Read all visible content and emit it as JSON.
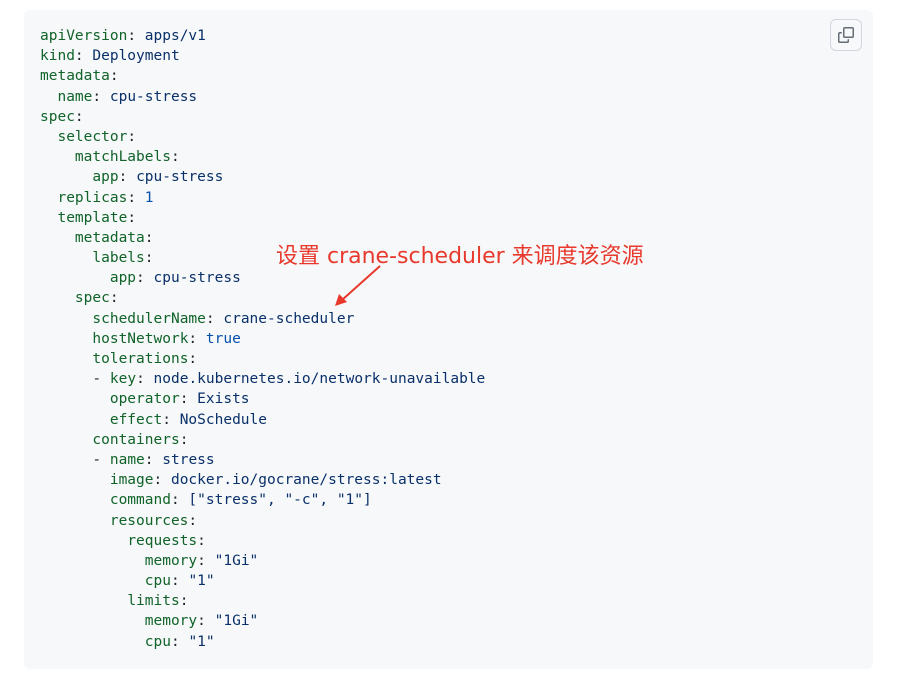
{
  "code": {
    "lines": [
      {
        "indent": "",
        "dash": "",
        "key": "apiVersion",
        "value": "apps/v1",
        "vclass": "v"
      },
      {
        "indent": "",
        "dash": "",
        "key": "kind",
        "value": "Deployment",
        "vclass": "v"
      },
      {
        "indent": "",
        "dash": "",
        "key": "metadata",
        "value": "",
        "vclass": "v"
      },
      {
        "indent": "  ",
        "dash": "",
        "key": "name",
        "value": "cpu-stress",
        "vclass": "v"
      },
      {
        "indent": "",
        "dash": "",
        "key": "spec",
        "value": "",
        "vclass": "v"
      },
      {
        "indent": "  ",
        "dash": "",
        "key": "selector",
        "value": "",
        "vclass": "v"
      },
      {
        "indent": "    ",
        "dash": "",
        "key": "matchLabels",
        "value": "",
        "vclass": "v"
      },
      {
        "indent": "      ",
        "dash": "",
        "key": "app",
        "value": "cpu-stress",
        "vclass": "v"
      },
      {
        "indent": "  ",
        "dash": "",
        "key": "replicas",
        "value": "1",
        "vclass": "n"
      },
      {
        "indent": "  ",
        "dash": "",
        "key": "template",
        "value": "",
        "vclass": "v"
      },
      {
        "indent": "    ",
        "dash": "",
        "key": "metadata",
        "value": "",
        "vclass": "v"
      },
      {
        "indent": "      ",
        "dash": "",
        "key": "labels",
        "value": "",
        "vclass": "v"
      },
      {
        "indent": "        ",
        "dash": "",
        "key": "app",
        "value": "cpu-stress",
        "vclass": "v"
      },
      {
        "indent": "    ",
        "dash": "",
        "key": "spec",
        "value": "",
        "vclass": "v"
      },
      {
        "indent": "      ",
        "dash": "",
        "key": "schedulerName",
        "value": "crane-scheduler",
        "vclass": "v"
      },
      {
        "indent": "      ",
        "dash": "",
        "key": "hostNetwork",
        "value": "true",
        "vclass": "n"
      },
      {
        "indent": "      ",
        "dash": "",
        "key": "tolerations",
        "value": "",
        "vclass": "v"
      },
      {
        "indent": "      ",
        "dash": "- ",
        "key": "key",
        "value": "node.kubernetes.io/network-unavailable",
        "vclass": "v"
      },
      {
        "indent": "        ",
        "dash": "",
        "key": "operator",
        "value": "Exists",
        "vclass": "v"
      },
      {
        "indent": "        ",
        "dash": "",
        "key": "effect",
        "value": "NoSchedule",
        "vclass": "v"
      },
      {
        "indent": "      ",
        "dash": "",
        "key": "containers",
        "value": "",
        "vclass": "v"
      },
      {
        "indent": "      ",
        "dash": "- ",
        "key": "name",
        "value": "stress",
        "vclass": "v"
      },
      {
        "indent": "        ",
        "dash": "",
        "key": "image",
        "value": "docker.io/gocrane/stress:latest",
        "vclass": "v"
      },
      {
        "indent": "        ",
        "dash": "",
        "key": "command",
        "value": "[\"stress\", \"-c\", \"1\"]",
        "vclass": "v"
      },
      {
        "indent": "        ",
        "dash": "",
        "key": "resources",
        "value": "",
        "vclass": "v"
      },
      {
        "indent": "          ",
        "dash": "",
        "key": "requests",
        "value": "",
        "vclass": "v"
      },
      {
        "indent": "            ",
        "dash": "",
        "key": "memory",
        "value": "\"1Gi\"",
        "vclass": "v"
      },
      {
        "indent": "            ",
        "dash": "",
        "key": "cpu",
        "value": "\"1\"",
        "vclass": "v"
      },
      {
        "indent": "          ",
        "dash": "",
        "key": "limits",
        "value": "",
        "vclass": "v"
      },
      {
        "indent": "            ",
        "dash": "",
        "key": "memory",
        "value": "\"1Gi\"",
        "vclass": "v"
      },
      {
        "indent": "            ",
        "dash": "",
        "key": "cpu",
        "value": "\"1\"",
        "vclass": "v"
      }
    ]
  },
  "annotation": {
    "text": "设置 crane-scheduler 来调度该资源",
    "color": "#e8392c"
  },
  "copy_button": {
    "icon": "copy-icon"
  }
}
